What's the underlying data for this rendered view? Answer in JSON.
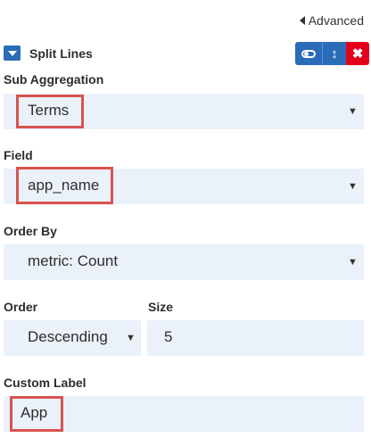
{
  "header": {
    "advanced_label": "Advanced"
  },
  "aggregation": {
    "title": "Split Lines",
    "toggle_icon": "toggle-icon",
    "move_icon": "move-vertical-icon",
    "remove_icon": "close-icon",
    "colors": {
      "primary": "#2b6cb8",
      "danger": "#e4001b",
      "field_bg": "#ebf1f9",
      "highlight": "#d9534f"
    }
  },
  "sub_aggregation": {
    "label": "Sub Aggregation",
    "value": "Terms"
  },
  "field": {
    "label": "Field",
    "value": "app_name"
  },
  "order_by": {
    "label": "Order By",
    "value": "metric: Count"
  },
  "order": {
    "label": "Order",
    "value": "Descending"
  },
  "size": {
    "label": "Size",
    "value": "5"
  },
  "custom_label": {
    "label": "Custom Label",
    "value": "App"
  }
}
